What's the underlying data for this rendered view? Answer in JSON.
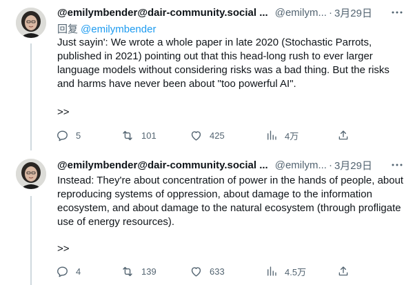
{
  "tweets": [
    {
      "display_name": "@emilymbender@dair-community.social ...",
      "handle": "@emilym...",
      "separator": "·",
      "time": "3月29日",
      "reply_to_label": "回复",
      "reply_to_mention": "@emilymbender",
      "text": "Just sayin': We wrote a whole paper in late 2020 (Stochastic Parrots, published in 2021) pointing out that this head-long rush to ever larger language models without considering risks was a bad thing. But the risks and harms have never been about \"too powerful AI\".",
      "continuation": ">>",
      "replies": "5",
      "retweets": "101",
      "likes": "425",
      "views": "4万"
    },
    {
      "display_name": "@emilymbender@dair-community.social ...",
      "handle": "@emilym...",
      "separator": "·",
      "time": "3月29日",
      "text": "Instead: They're about concentration of power in the hands of people, about reproducing systems of oppression, about damage to the information ecosystem, and about damage to the natural ecosystem (through profligate use of energy resources).",
      "continuation": ">>",
      "replies": "4",
      "retweets": "139",
      "likes": "633",
      "views": "4.5万"
    }
  ],
  "icons": {
    "reply": "reply-icon",
    "retweet": "retweet-icon",
    "like": "heart-icon",
    "views": "views-icon",
    "share": "share-icon",
    "more": "more-icon"
  },
  "colors": {
    "text": "#0f1419",
    "secondary": "#536471",
    "link": "#1d9bf0",
    "thread_line": "#cfd9de"
  }
}
